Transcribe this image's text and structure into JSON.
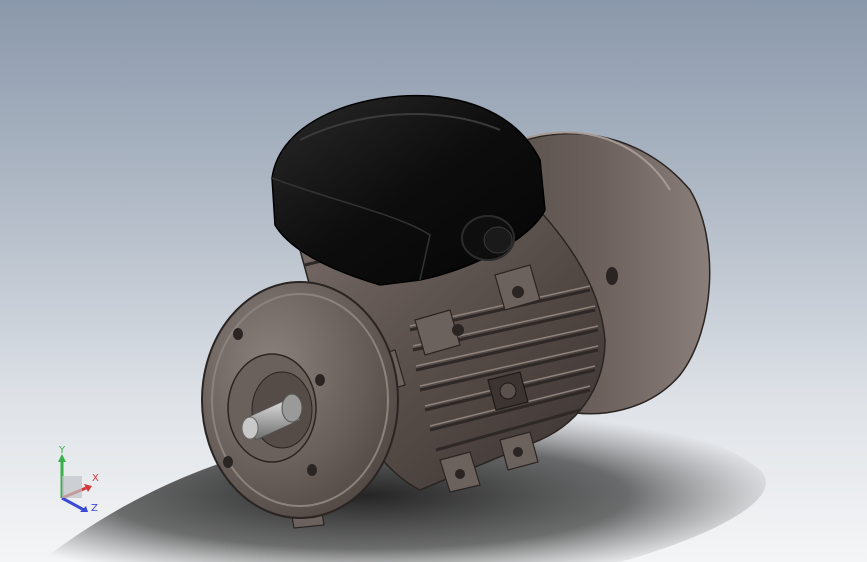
{
  "viewport": {
    "background_top": "#8a98ab",
    "background_bottom": "#f4f5f6"
  },
  "model": {
    "body_color": "#5a504c",
    "terminal_box_color": "#101010",
    "shaft_color": "#b9b9b9"
  },
  "triad": {
    "y_label": "Y",
    "x_label": "X",
    "z_label": "Z",
    "x_color": "#d23a3a",
    "y_color": "#3ab04a",
    "z_color": "#3a4ad2"
  }
}
